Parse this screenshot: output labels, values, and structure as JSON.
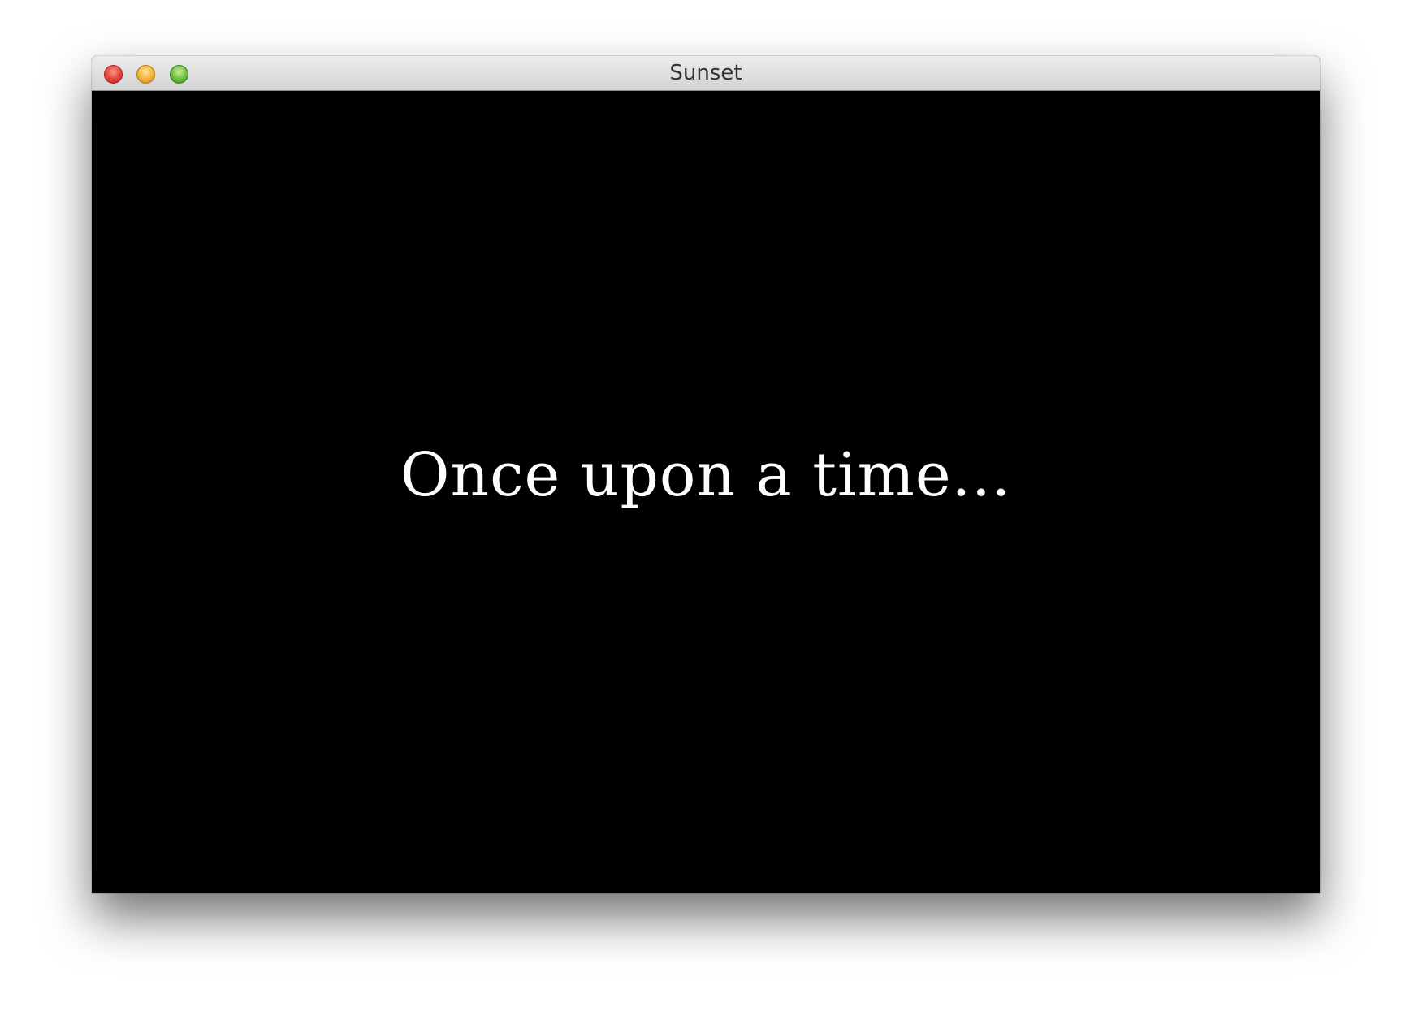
{
  "window": {
    "title": "Sunset",
    "controls": {
      "close": "close-button",
      "minimize": "minimize-button",
      "zoom": "zoom-button"
    }
  },
  "content": {
    "text": "Once upon a time...",
    "background_color": "#000000",
    "text_color": "#ffffff"
  }
}
